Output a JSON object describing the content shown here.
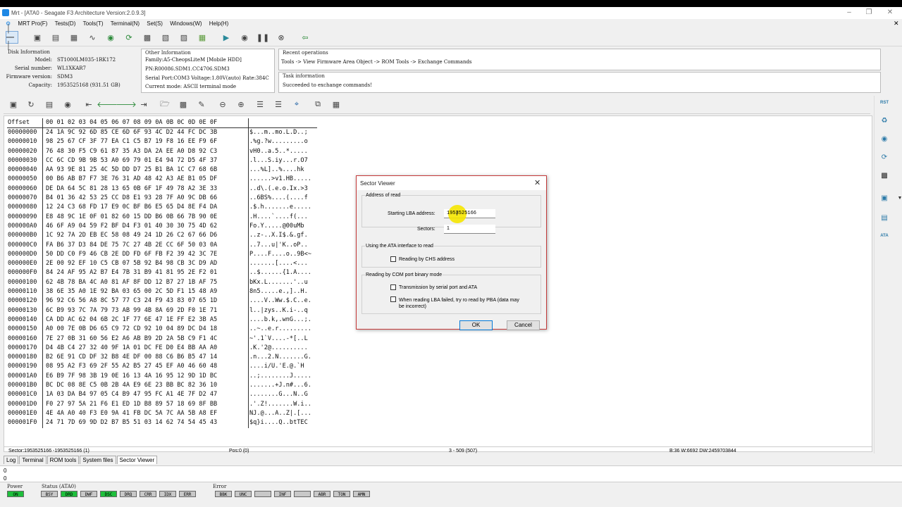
{
  "window": {
    "title": "Mrt - [ATA0 - Seagate F3 Architecture Version:2.0.9.3]"
  },
  "menu": [
    "MRT Pro(F)",
    "Tests(D)",
    "Tools(T)",
    "Terminal(N)",
    "Set(S)",
    "Windows(W)",
    "Help(H)"
  ],
  "disk": {
    "header": "Disk Information",
    "model_label": "Model:",
    "model": "ST1000LM035-1RK172",
    "serial_label": "Serial number:",
    "serial": "WL1XKAR7",
    "fw_label": "Firmware version:",
    "fw": "SDM3",
    "cap_label": "Capacity:",
    "cap": "1953525168 (931.51 GB)"
  },
  "other": {
    "header": "Other Information",
    "family": "Family:A5-CheopsLiteM [Mobile HDD]",
    "pn": "PN:R00086.SDM1.CC4706.SDM3",
    "port": "Serial Port:COM3 Voltage:1.80V(auto) Rate:384C",
    "mode": "Current mode: ASCII terminal mode"
  },
  "recent": {
    "header": "Recent operations",
    "path": "Tools -> View Firmware Area Object -> ROM Tools -> Exchange Commands"
  },
  "task": {
    "header": "Task information",
    "message": "Succeeded to exchange commands!"
  },
  "hex": {
    "header_offset": "Offset",
    "header_bytes": "00 01 02 03 04 05 06 07 08 09 0A 0B 0C 0D 0E 0F",
    "offsets": [
      "00000000",
      "00000010",
      "00000020",
      "00000030",
      "00000040",
      "00000050",
      "00000060",
      "00000070",
      "00000080",
      "00000090",
      "000000A0",
      "000000B0",
      "000000C0",
      "000000D0",
      "000000E0",
      "000000F0",
      "00000100",
      "00000110",
      "00000120",
      "00000130",
      "00000140",
      "00000150",
      "00000160",
      "00000170",
      "00000180",
      "00000190",
      "000001A0",
      "000001B0",
      "000001C0",
      "000001D0",
      "000001E0",
      "000001F0"
    ],
    "bytes": [
      "24 1A 9C 92 6D 85 CE 6D 6F 93 4C D2 44 FC DC 3B",
      "98 25 67 CF 3F 77 EA C1 C5 B7 19 F8 16 EE F9 6F",
      "76 48 30 F5 C9 61 87 35 A3 DA 2A EE A0 D8 92 C3",
      "CC 6C CD 9B 9B 53 A0 69 79 01 E4 94 72 D5 4F 37",
      "AA 93 9E 81 25 4C 5D DD D7 25 B1 BA 1C C7 68 6B",
      "00 B6 AB B7 F7 3E 76 31 AD 48 42 A3 AE B1 05 DF",
      "DE DA 64 5C 81 28 13 65 0B 6F 1F 49 78 A2 3E 33",
      "B4 01 36 42 53 25 CC D8 E1 93 28 7F A0 9C DB 66",
      "12 24 C3 68 FD 17 E9 0C BF B6 E5 65 D4 8E F4 DA",
      "E8 48 9C 1E 0F 01 82 60 15 DD B6 0B 66 7B 90 0E",
      "46 6F A9 04 59 F2 BF D4 F3 01 40 30 30 75 4D 62",
      "1C 92 7A 2D EB EC 58 08 49 24 1D 26 C2 67 66 D6",
      "FA B6 37 D3 84 DE 75 7C 27 4B 2E CC 6F 50 03 0A",
      "50 DD C0 F9 46 CB 2E DD FD 6F FB F2 39 42 3C 7E",
      "2E 00 92 EF 10 C5 CB 07 5B 92 B4 98 CB 3C D9 AD",
      "84 24 AF 95 A2 B7 E4 7B 31 B9 41 81 95 2E F2 01",
      "62 4B 78 BA 4C A0 81 AF 8F DD 12 B7 27 1B AF 75",
      "38 6E 35 A0 1E 92 BA 03 65 00 2C 5D F1 15 48 A9",
      "96 92 C6 56 A8 8C 57 77 C3 24 F9 43 83 07 65 1D",
      "6C B9 93 7C 7A 79 73 AB 99 4B 8A 69 2D F0 1E 71",
      "CA DD AC 62 04 6B 2C 1F 77 6E 47 1E FF E2 3B A5",
      "A0 00 7E 0B D6 65 C9 72 CD 92 10 04 89 DC D4 18",
      "7E 27 0B 31 60 56 E2 A6 AB B9 2D 2A 5B C9 F1 4C",
      "D4 4B C4 27 32 40 9F 1A 01 DC FE D0 E4 BB AA A0",
      "B2 6E 91 CD DF 32 B8 4E DF 00 88 C6 B6 B5 47 14",
      "08 95 A2 F3 69 2F 55 A2 B5 27 45 EF A0 46 60 48",
      "E6 B9 7F 98 3B 19 0E 16 13 4A 16 95 12 9D 1D BC",
      "BC DC 08 8E C5 0B 2B 4A E9 6E 23 BB BC 82 36 10",
      "1A 03 DA B4 97 05 C4 B9 47 95 FC A1 4E 7F D2 47",
      "F0 27 97 5A 21 F6 E1 ED 1D B8 89 57 18 69 8F BB",
      "4E 4A A0 40 F3 E0 9A 41 FB DC 5A 7C AA 5B A8 EF",
      "24 71 7D 69 9D D2 B7 B5 51 03 14 62 74 54 45 43"
    ],
    "ascii": [
      "$...m..mo.L.D..;",
      ".%g.?w.........o",
      "vH0..a.5..*.....",
      ".l...S.iy...r.O7",
      "...%L]..%....hk",
      "......>v1.HB.....",
      "..d\\.(.e.o.Ix.>3",
      "..6BS%....(....f",
      ".$.h.......e.....",
      ".H....`....f(...",
      "Fo.Y.....@00uMb",
      "..z-..X.I$.&.gf.",
      "..7...u|'K..oP..",
      "P....F....o..9B<~",
      ".......[....<...",
      "..$......{1.A....",
      "bKx.L.......'..u",
      "8n5.....e.,]..H.",
      "....V..Ww.$.C..e.",
      "l..|zys..K.i-..q",
      "....b.k,.wnG...;.",
      "..~..e.r.........",
      "~'.1`V....-*[..L",
      ".K.'2@..........",
      ".n...2.N.......G.",
      "....i/U.'E.@.`H",
      "..;........J.....",
      ".......+J.n#...6.",
      "........G...N..G",
      ".'.Z!.......W.i..",
      "NJ.@...A..Z|.[...",
      "$q}i....Q..btTEC"
    ]
  },
  "dialog": {
    "title": "Sector Viewer",
    "addr_group": "Address of read",
    "lba_label": "Starting LBA address:",
    "lba_value": "1953525166",
    "sectors_label": "Sectors:",
    "sectors_value": "1",
    "ata_group": "Using the ATA interface to read",
    "chs_label": "Reading by CHS address",
    "com_group": "Reading by COM port binary mode",
    "serial_ata_label": "Transmission by serial port and ATA",
    "pba_label": "When reading  LBA failed, try ro read by PBA (data may be incorrect)",
    "ok": "OK",
    "cancel": "Cancel"
  },
  "statusbar": {
    "sector": "Sector:1953525166 -1953525166 (1)",
    "pos": "Pos:0 (0)",
    "range": "3 - 509 (507)",
    "info": "B:36 W:6692 DW:2459703844"
  },
  "tabs": [
    "Log",
    "Terminal",
    "ROM tools",
    "System files",
    "Sector Viewer"
  ],
  "log": {
    "line1": "0",
    "line2": "0"
  },
  "power": {
    "label": "Power",
    "on": "ON"
  },
  "status": {
    "label": "Status (ATA0)",
    "leds": [
      "BSY",
      "DRD",
      "DWF",
      "DSC",
      "DRQ",
      "CRR",
      "IDX",
      "ERR"
    ]
  },
  "error": {
    "label": "Error",
    "leds": [
      "BBK",
      "UNC",
      "",
      "INF",
      "",
      "ABR",
      "TON",
      "AMN"
    ]
  },
  "colors": {
    "led_green": "#1fbf3c",
    "led_gray": "#c8c8c8",
    "dialog_border": "#c53a3a",
    "highlight": "#f5e600"
  }
}
